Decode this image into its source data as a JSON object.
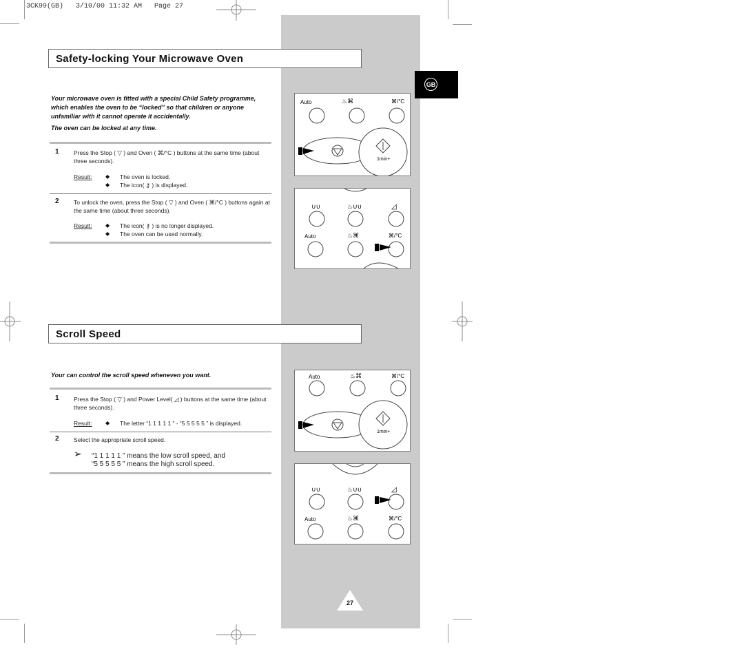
{
  "slug_line": "3CK99(GB)   3/10/00 11:32 AM   Page 27",
  "language_tab": "GB",
  "page_number": "27",
  "sections": [
    {
      "title": "Safety-locking Your Microwave Oven",
      "intro": "Your microwave oven is fitted with a special Child Safety programme, which enables the oven to be “locked” so that children or anyone unfamiliar with it cannot operate it accidentally.",
      "intro_note": "The oven can be locked at any time.",
      "steps": [
        {
          "number": "1",
          "text": "Press the Stop ( ▽ ) and Oven ( ⌘/°C )  buttons at the same time (about three seconds).",
          "result_label": "Result:",
          "results": [
            "The oven is locked.",
            "The icon( ⚷ ) is displayed."
          ]
        },
        {
          "number": "2",
          "text": "To unlock the oven, press the Stop ( ▽ ) and Oven ( ⌘/°C ) buttons again at the same time (about three seconds).",
          "result_label": "Result:",
          "results": [
            "The  icon( ⚷ ) is no longer displayed.",
            "The oven can be used normally."
          ]
        }
      ]
    },
    {
      "title": "Scroll Speed",
      "intro": "Your can control the scroll speed wheneven you want.",
      "steps": [
        {
          "number": "1",
          "text": "Press the Stop ( ▽ ) and Power Level( ◿ )  buttons at the same time (about three seconds).",
          "result_label": "Result:",
          "results": [
            "The letter “1 1 1 1 1 ” - “5 5 5 5 5 ” is displayed."
          ]
        },
        {
          "number": "2",
          "text": "Select the appropriate scroll speed.",
          "note_lines": [
            "“1  1  1  1  1 ” means the low scroll speed, and",
            "“5 5 5 5 5 ” means the high scroll speed."
          ]
        }
      ]
    }
  ],
  "panel_labels": {
    "auto": "Auto",
    "oven_c": "⌘/°C",
    "defrost_fan": "♨⌘",
    "micro": "∪∪",
    "defrost_micro": "♨∪∪",
    "power": "◿",
    "one_min": "1min+"
  },
  "colors": {
    "gray_column": "#cbcbcb",
    "tab_bg": "#000000",
    "panel_border": "#777777"
  }
}
